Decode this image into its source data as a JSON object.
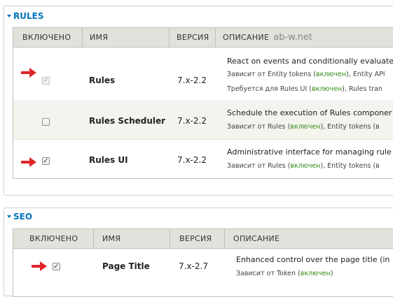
{
  "groups": {
    "rules": {
      "title": "RULES",
      "headers": {
        "enabled": "ВКЛЮЧЕНО",
        "name": "ИМЯ",
        "version": "ВЕРСИЯ",
        "description": "ОПИСАНИЕ",
        "watermark": "ab-w.net"
      },
      "rows": [
        {
          "name": "Rules",
          "version": "7.x-2.2",
          "checked": true,
          "disabled": true,
          "description": "React on events and conditionally evaluate",
          "requires_prefix": "Зависит от Entity tokens (",
          "requires_status": "включен",
          "requires_suffix": "), Entity API",
          "required_by_prefix": "Требуется для Rules UI (",
          "required_by_status": "включен",
          "required_by_suffix": "), Rules tran"
        },
        {
          "name": "Rules Scheduler",
          "version": "7.x-2.2",
          "checked": false,
          "disabled": false,
          "description": "Schedule the execution of Rules componer",
          "requires_prefix": "Зависит от Rules (",
          "requires_status": "включен",
          "requires_suffix": "), Entity tokens (в"
        },
        {
          "name": "Rules UI",
          "version": "7.x-2.2",
          "checked": true,
          "disabled": false,
          "description": "Administrative interface for managing rule",
          "requires_prefix": "Зависит от Rules (",
          "requires_status": "включен",
          "requires_suffix": "), Entity tokens (в"
        }
      ]
    },
    "seo": {
      "title": "SEO",
      "headers": {
        "enabled": "ВКЛЮЧЕНО",
        "name": "ИМЯ",
        "version": "ВЕРСИЯ",
        "description": "ОПИСАНИЕ"
      },
      "rows": [
        {
          "name": "Page Title",
          "version": "7.x-2.7",
          "checked": true,
          "disabled": false,
          "description": "Enhanced control over the page title (in",
          "requires_prefix": "Зависит от Token (",
          "requires_status": "включен",
          "requires_suffix": ")"
        }
      ]
    }
  },
  "colors": {
    "legend": "#0074bd",
    "enabled_text": "#2d8a11",
    "arrow": "#e0262b"
  }
}
